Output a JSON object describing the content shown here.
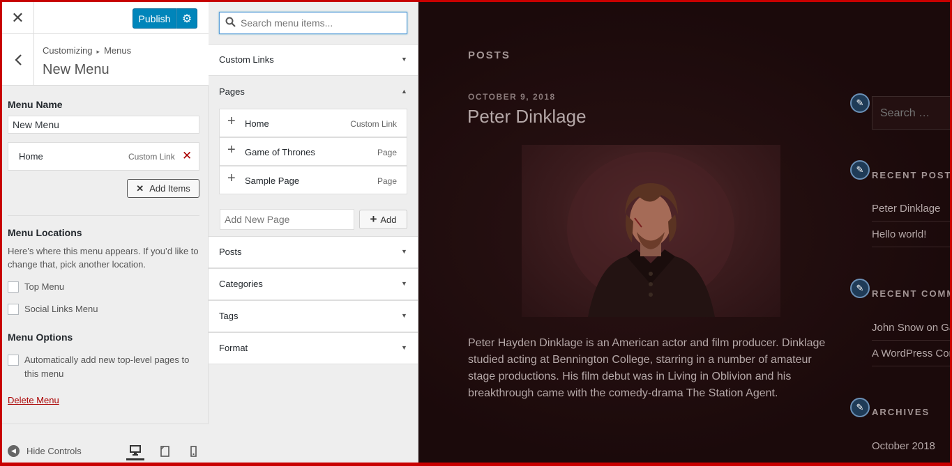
{
  "topbar": {
    "close_icon": "close-icon",
    "publish_label": "Publish",
    "settings_icon": "gear-icon"
  },
  "header": {
    "back_icon": "chevron-left-icon",
    "breadcrumb_root": "Customizing",
    "breadcrumb_child": "Menus",
    "title": "New Menu"
  },
  "menu": {
    "name_label": "Menu Name",
    "name_value": "New Menu",
    "items": [
      {
        "title": "Home",
        "type": "Custom Link"
      }
    ],
    "add_items_label": "Add Items",
    "locations_label": "Menu Locations",
    "locations_desc": "Here’s where this menu appears. If you’d like to change that, pick another location.",
    "locations": [
      "Top Menu",
      "Social Links Menu"
    ],
    "options_label": "Menu Options",
    "auto_add_label": "Automatically add new top-level pages to this menu",
    "delete_label": "Delete Menu"
  },
  "footer": {
    "hide_controls_label": "Hide Controls",
    "devices": [
      "desktop-icon",
      "tablet-icon",
      "mobile-icon"
    ]
  },
  "available": {
    "search_placeholder": "Search menu items...",
    "sections_top": [
      {
        "title": "Custom Links"
      }
    ],
    "pages_title": "Pages",
    "pages": [
      {
        "title": "Home",
        "type": "Custom Link"
      },
      {
        "title": "Game of Thrones",
        "type": "Page"
      },
      {
        "title": "Sample Page",
        "type": "Page"
      }
    ],
    "new_page_placeholder": "Add New Page",
    "add_label": "Add",
    "sections_bottom": [
      {
        "title": "Posts"
      },
      {
        "title": "Categories"
      },
      {
        "title": "Tags"
      },
      {
        "title": "Format"
      }
    ]
  },
  "preview": {
    "posts_heading": "POSTS",
    "date": "OCTOBER 9, 2018",
    "post_title": "Peter Dinklage",
    "post_body": "Peter Hayden Dinklage is an American actor and film producer. Dinklage studied acting at Bennington College, starring in a number of amateur stage productions. His film debut was in Living in Oblivion and his breakthrough came with the comedy-drama The Station Agent.",
    "search_placeholder": "Search …",
    "recent_posts_title": "RECENT POSTS",
    "recent_posts": [
      "Peter Dinklage",
      "Hello world!"
    ],
    "recent_comments_title": "RECENT COMME",
    "recent_comments": [
      "John Snow on Ga",
      "A WordPress Cor"
    ],
    "archives_title": "ARCHIVES",
    "archives": [
      "October 2018"
    ]
  },
  "colors": {
    "accent": "#0085ba",
    "delete": "#aa0000",
    "preview_bg": "#1b0a0b",
    "frame": "#c80000"
  }
}
